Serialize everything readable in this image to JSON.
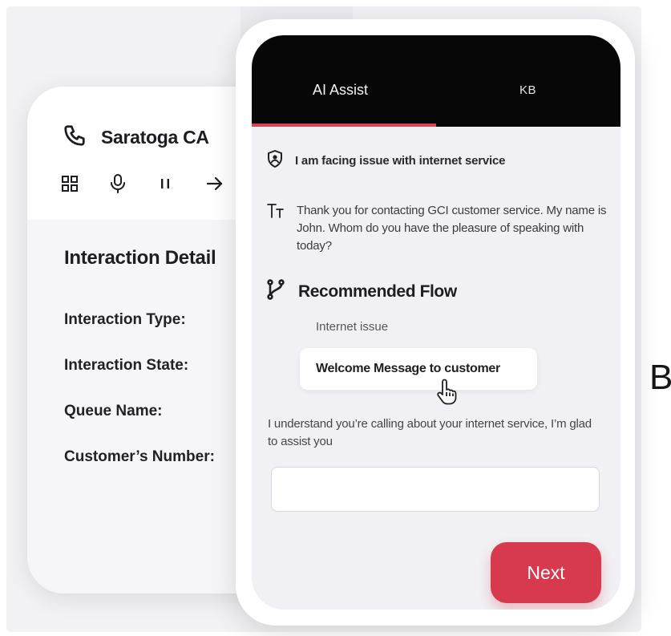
{
  "left_card": {
    "location": "Saratoga CA",
    "toolbar_icons": [
      "grid-icon",
      "microphone-icon",
      "pause-icon",
      "transfer-arrow-icon"
    ],
    "details_title": "Interaction Detail",
    "fields": [
      {
        "label": "Interaction Type:"
      },
      {
        "label": "Interaction State:"
      },
      {
        "label": "Queue Name:"
      },
      {
        "label": "Customer’s Number:"
      }
    ]
  },
  "assist": {
    "tabs": [
      {
        "label": "AI Assist",
        "active": true
      },
      {
        "label": "KB",
        "active": false
      }
    ],
    "customer_message": "I am facing issue with internet service",
    "agent_message": "Thank you for contacting GCI customer service. My name is John. Whom do you have the pleasure of speaking with today?",
    "recommended_flow": {
      "title": "Recommended Flow",
      "subtitle": "Internet issue",
      "action_label": "Welcome Message to customer"
    },
    "suggested_reply": "I understand you’re calling about your internet service, I’m glad to assist you",
    "reply_input": {
      "value": "",
      "placeholder": ""
    },
    "next_label": "Next"
  },
  "edge_letter": "B",
  "colors": {
    "accent": "#d73a4c",
    "tab_bar": "#070707",
    "screen_bg": "#f1f1f5",
    "card_bg": "#ffffff"
  }
}
